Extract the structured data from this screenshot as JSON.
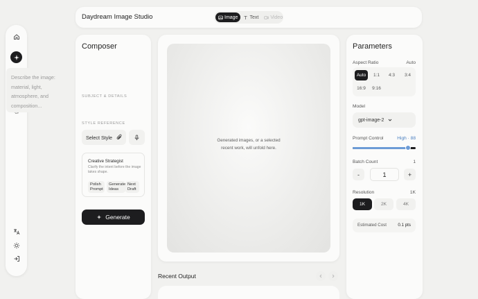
{
  "app": {
    "title": "Daydream Image Studio"
  },
  "mode_tabs": [
    {
      "label": "Image",
      "icon": "image-icon",
      "state": "active"
    },
    {
      "label": "Text",
      "icon": "text-icon",
      "state": "normal"
    },
    {
      "label": "Video",
      "icon": "video-icon",
      "state": "disabled"
    }
  ],
  "rail": {
    "top_icons": [
      "home-icon",
      "sparkle-icon",
      "search-icon",
      "user-icon",
      "gear-icon"
    ],
    "bottom_icons": [
      "translate-icon",
      "sun-icon",
      "logout-icon"
    ]
  },
  "composer": {
    "title": "Composer",
    "subject_label": "SUBJECT & DETAILS",
    "subject_placeholder": "Describe the image: material, light, atmosphere, and composition...",
    "style_label": "STYLE REFERENCE",
    "select_style": "Select Style",
    "strategist": {
      "title": "Creative Strategist",
      "description": "Clarify the intent before the image takes shape.",
      "chips": [
        "Polish Prompt",
        "Generate Ideas",
        "Next Draft"
      ]
    },
    "generate_label": "Generate"
  },
  "canvas": {
    "hint": "Generated images, or a selected recent work, will unfold here."
  },
  "recent": {
    "title": "Recent Output"
  },
  "parameters": {
    "title": "Parameters",
    "aspect": {
      "label": "Aspect Ratio",
      "value": "Auto",
      "options": [
        "Auto",
        "1:1",
        "4:3",
        "3:4",
        "16:9",
        "9:16"
      ],
      "selected": "Auto"
    },
    "model": {
      "label": "Model",
      "value": "gpt-image-2"
    },
    "prompt_control": {
      "label": "Prompt Control",
      "value": "High · 88",
      "level": 88
    },
    "batch": {
      "label": "Batch Count",
      "value": "1",
      "count": "1",
      "minus": "-",
      "plus": "+"
    },
    "resolution": {
      "label": "Resolution",
      "value": "1K",
      "options": [
        "1K",
        "2K",
        "4K"
      ],
      "selected": "1K"
    },
    "cost": {
      "label": "Estimated Cost",
      "value": "0.1 pts"
    }
  },
  "colors": {
    "accent": "#1d1d1f",
    "slider": "#6c9bd6",
    "background": "#f1f1ef"
  }
}
